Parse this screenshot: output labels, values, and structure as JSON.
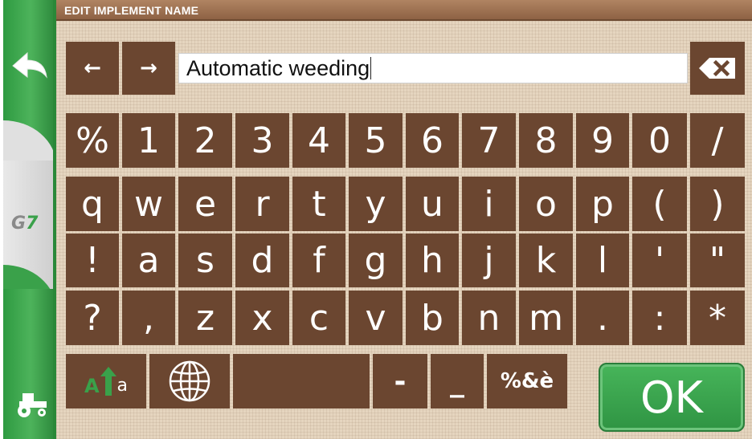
{
  "header": {
    "title": "EDIT IMPLEMENT NAME"
  },
  "sidebar": {
    "back_icon": "back-arrow-icon",
    "logo": {
      "g": "G",
      "seven": "7"
    },
    "tractor_icon": "tractor-icon"
  },
  "editor": {
    "value": "Automatic weeding",
    "left_arrow": "←",
    "right_arrow": "→",
    "backspace_icon": "backspace-icon"
  },
  "keyboard": {
    "row1": [
      "%",
      "1",
      "2",
      "3",
      "4",
      "5",
      "6",
      "7",
      "8",
      "9",
      "0",
      "/"
    ],
    "row2": [
      "q",
      "w",
      "e",
      "r",
      "t",
      "y",
      "u",
      "i",
      "o",
      "p",
      "(",
      ")"
    ],
    "row3": [
      "!",
      "a",
      "s",
      "d",
      "f",
      "g",
      "h",
      "j",
      "k",
      "l",
      "'",
      "\""
    ],
    "row4": [
      "?",
      ",",
      "z",
      "x",
      "c",
      "v",
      "b",
      "n",
      "m",
      ".",
      ":",
      "*"
    ],
    "bottom": {
      "shift_icon": "shift-case-icon",
      "shift_big": "A",
      "shift_small": "a",
      "globe_icon": "globe-icon",
      "space": "",
      "dash": "-",
      "underscore": "_",
      "symbols": "%&è",
      "ok": "OK"
    }
  },
  "colors": {
    "key": "#6b4630",
    "accent_green": "#3aa14a",
    "header": "#9a6e4f",
    "background": "#e5d5bf"
  }
}
